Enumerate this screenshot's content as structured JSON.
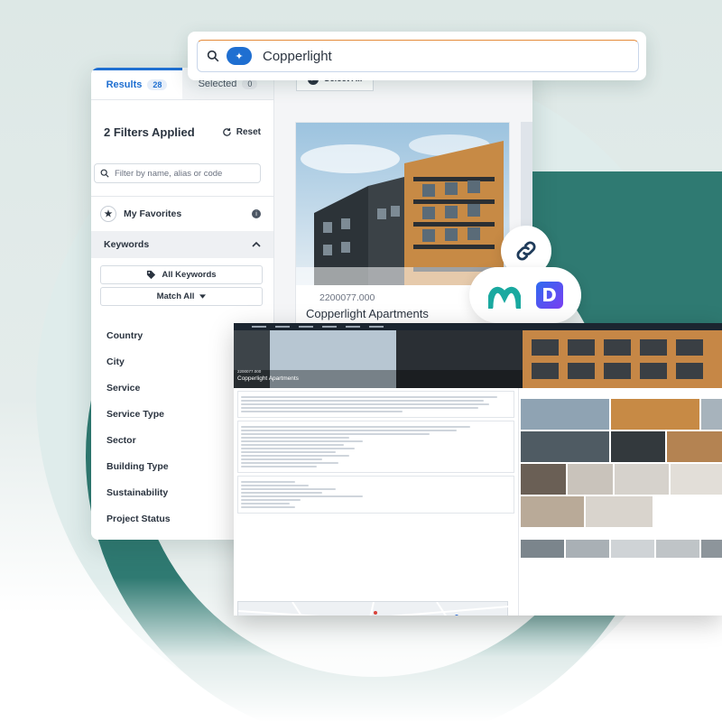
{
  "search": {
    "value": "Copperlight"
  },
  "tabs": [
    {
      "label": "Results",
      "count": "28"
    },
    {
      "label": "Selected",
      "count": "0"
    }
  ],
  "toolbar": {
    "select_all": "Select All"
  },
  "filters": {
    "title": "2 Filters Applied",
    "reset": "Reset",
    "placeholder": "Filter by name, alias or code"
  },
  "favorites": {
    "label": "My Favorites"
  },
  "keywords": {
    "heading": "Keywords",
    "all_keywords": "All Keywords",
    "match_all": "Match All"
  },
  "facets": [
    "Country",
    "City",
    "Service",
    "Service Type",
    "Sector",
    "Building Type",
    "Sustainability",
    "Project Status"
  ],
  "card": {
    "code": "2200077.000",
    "title": "Copperlight Apartments"
  },
  "detail": {
    "code": "2200077.000",
    "title": "Copperlight Apartments"
  },
  "colors": {
    "accent": "#1f6fd1",
    "teal": "#2f7a72"
  },
  "icons": {
    "search": "search-icon",
    "ai": "sparkle-icon",
    "link": "link-icon",
    "reset": "refresh-icon",
    "star": "star-icon",
    "info": "info-icon",
    "tag": "tag-icon",
    "chevron": "chevron-up-icon"
  }
}
